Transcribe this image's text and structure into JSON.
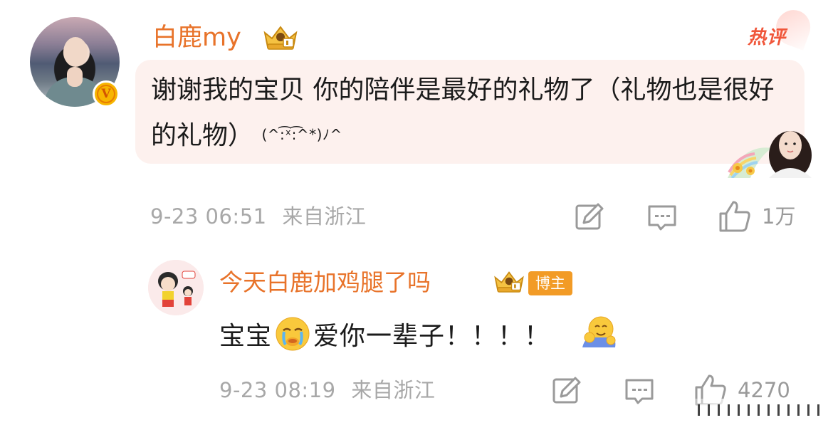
{
  "main_comment": {
    "username": "白鹿my",
    "hot_tag": "热评",
    "text": "谢谢我的宝贝 你的陪伴是最好的礼物了（礼物也是很好的礼物）",
    "kaomoji": "(^:͡ˣ:͡^*)ﾉ^",
    "timestamp": "9-23 06:51",
    "location": "来自浙江",
    "like_count": "1万",
    "verified_badge": "V"
  },
  "reply": {
    "username": "今天白鹿加鸡腿了吗",
    "role_tag": "博主",
    "text_before": "宝宝",
    "text_after": "爱你一辈子！！！！",
    "timestamp": "9-23 08:19",
    "location": "来自浙江",
    "like_count": "4270"
  },
  "icons": {
    "crown": "vip-crown-icon",
    "repost": "repost-icon",
    "comment": "comment-icon",
    "like": "thumbs-up-icon",
    "cry_emoji": "crying-face-emoji",
    "hug_emoji": "hugging-emoji"
  },
  "colors": {
    "username": "#e8732a",
    "hot_tag": "#f0563a",
    "bubble_bg": "#fdf1ee",
    "meta_text": "#a8a8a8",
    "bozhu_bg": "#f29b26"
  }
}
